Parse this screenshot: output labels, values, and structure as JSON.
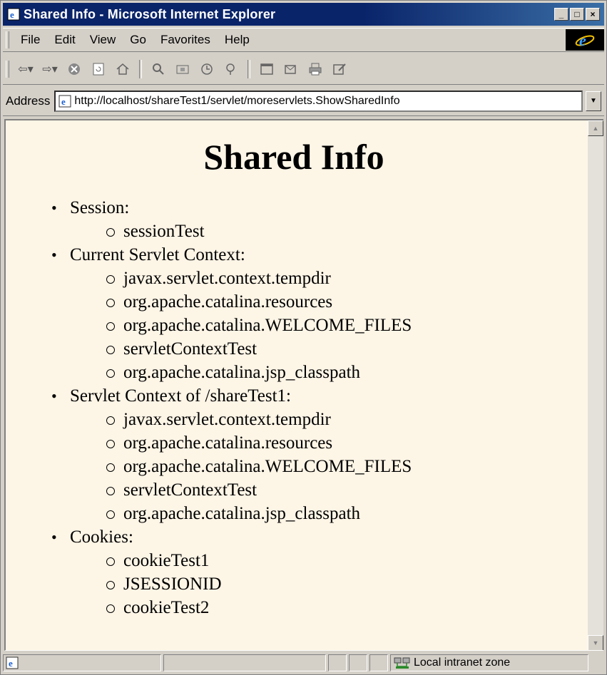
{
  "window": {
    "title": "Shared Info - Microsoft Internet Explorer",
    "controls": {
      "minimize": "_",
      "maximize": "□",
      "close": "×"
    }
  },
  "menubar": {
    "items": [
      {
        "label": "File"
      },
      {
        "label": "Edit"
      },
      {
        "label": "View"
      },
      {
        "label": "Go"
      },
      {
        "label": "Favorites"
      },
      {
        "label": "Help"
      }
    ]
  },
  "toolbar": {
    "icons": [
      "back-icon",
      "forward-icon",
      "stop-icon",
      "refresh-icon",
      "home-icon",
      "search-icon",
      "favorites-icon",
      "history-icon",
      "channels-icon",
      "fullscreen-icon",
      "mail-icon",
      "print-icon",
      "edit-icon"
    ]
  },
  "address": {
    "label": "Address",
    "url": "http://localhost/shareTest1/servlet/moreservlets.ShowSharedInfo"
  },
  "page": {
    "heading": "Shared Info",
    "sections": [
      {
        "label": "Session:",
        "items": [
          "sessionTest"
        ]
      },
      {
        "label": "Current Servlet Context:",
        "items": [
          "javax.servlet.context.tempdir",
          "org.apache.catalina.resources",
          "org.apache.catalina.WELCOME_FILES",
          "servletContextTest",
          "org.apache.catalina.jsp_classpath"
        ]
      },
      {
        "label": "Servlet Context of /shareTest1:",
        "items": [
          "javax.servlet.context.tempdir",
          "org.apache.catalina.resources",
          "org.apache.catalina.WELCOME_FILES",
          "servletContextTest",
          "org.apache.catalina.jsp_classpath"
        ]
      },
      {
        "label": "Cookies:",
        "items": [
          "cookieTest1",
          "JSESSIONID",
          "cookieTest2"
        ]
      }
    ]
  },
  "status": {
    "zone": "Local intranet zone"
  },
  "colors": {
    "titlebar": "#0a246a",
    "page_background": "#fdf5e6",
    "chrome": "#d4d0c8"
  }
}
